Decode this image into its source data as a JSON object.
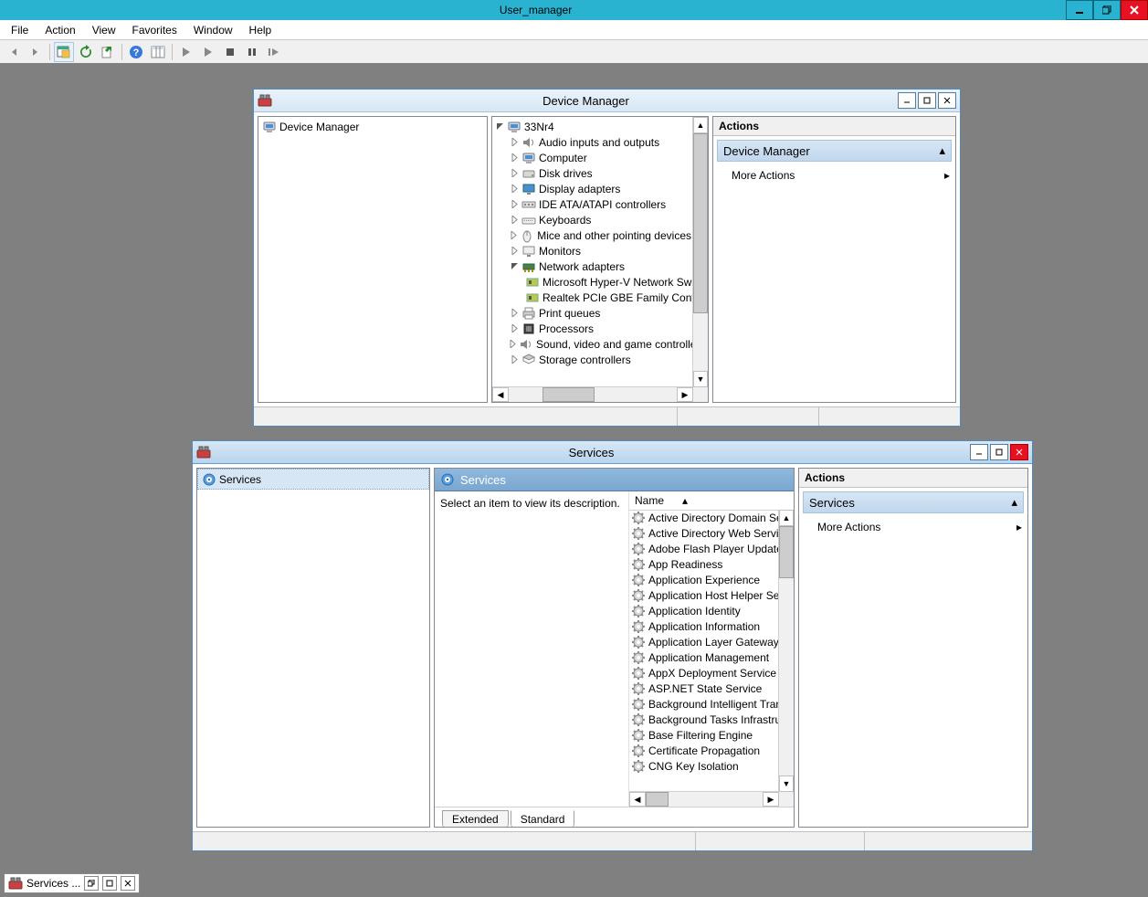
{
  "app": {
    "title": "User_manager"
  },
  "menus": {
    "file": "File",
    "action": "Action",
    "view": "View",
    "favorites": "Favorites",
    "window": "Window",
    "help": "Help"
  },
  "actions": {
    "header": "Actions",
    "more": "More Actions"
  },
  "devmgr": {
    "title": "Device Manager",
    "left_item": "Device Manager",
    "root": "33Nr4",
    "nodes": {
      "audio": "Audio inputs and outputs",
      "computer": "Computer",
      "disk": "Disk drives",
      "display": "Display adapters",
      "ide": "IDE ATA/ATAPI controllers",
      "keyboards": "Keyboards",
      "mice": "Mice and other pointing devices",
      "monitors": "Monitors",
      "network": "Network adapters",
      "net_hv": "Microsoft Hyper-V Network Switch Default Miniport",
      "net_rt": "Realtek PCIe GBE Family Controller",
      "print": "Print queues",
      "proc": "Processors",
      "sound": "Sound, video and game controllers",
      "storage": "Storage controllers"
    },
    "actions_section": "Device Manager"
  },
  "services": {
    "title": "Services",
    "left_item": "Services",
    "pane_title": "Services",
    "desc": "Select an item to view its description.",
    "col_name": "Name",
    "tabs": {
      "ext": "Extended",
      "std": "Standard"
    },
    "actions_section": "Services",
    "list": [
      "Active Directory Domain Services",
      "Active Directory Web Services",
      "Adobe Flash Player Update Service",
      "App Readiness",
      "Application Experience",
      "Application Host Helper Service",
      "Application Identity",
      "Application Information",
      "Application Layer Gateway Service",
      "Application Management",
      "AppX Deployment Service (AppXSVC)",
      "ASP.NET State Service",
      "Background Intelligent Transfer Service",
      "Background Tasks Infrastructure Service",
      "Base Filtering Engine",
      "Certificate Propagation",
      "CNG Key Isolation"
    ]
  },
  "taskbar": {
    "services": "Services ..."
  }
}
